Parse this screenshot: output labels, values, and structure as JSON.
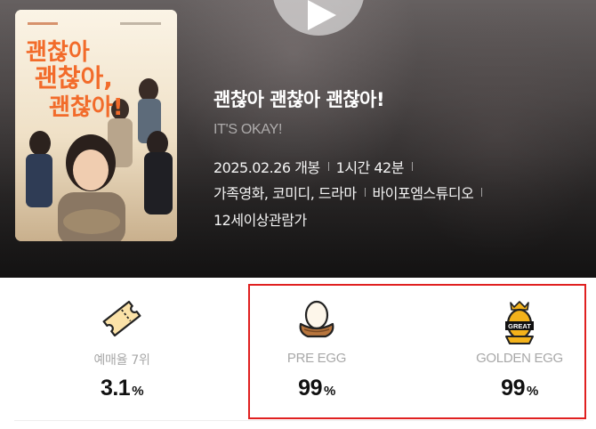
{
  "hero": {
    "title": "괜찮아 괜찮아 괜찮아!",
    "subtitle": "IT'S OKAY!",
    "release": "2025.02.26 개봉",
    "runtime": "1시간 42분",
    "genres": "가족영화, 코미디, 드라마",
    "distributor": "바이포엠스튜디오",
    "rating": "12세이상관람가",
    "poster_title_lines": [
      "괜찮아",
      "괜찮아,",
      "괜찮아!"
    ]
  },
  "stats": {
    "booking": {
      "label": "예매율 7위",
      "value": "3.1",
      "unit": "%",
      "icon": "ticket-icon"
    },
    "pre_egg": {
      "label": "PRE EGG",
      "value": "99",
      "unit": "%",
      "icon": "egg-nest-icon"
    },
    "golden_egg": {
      "label": "GOLDEN EGG",
      "value": "99",
      "unit": "%",
      "icon": "golden-egg-icon",
      "badge_text": "GREAT"
    }
  },
  "colors": {
    "highlight_border": "#e02020",
    "poster_title_orange": "#f26b2a",
    "golden_egg": "#f3b21b"
  }
}
